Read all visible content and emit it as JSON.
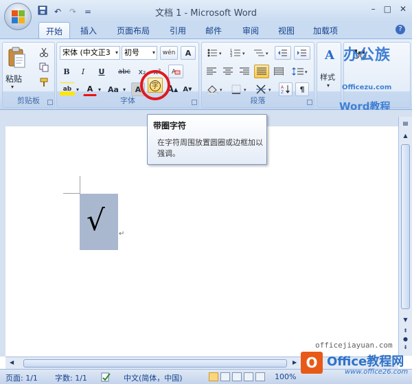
{
  "window": {
    "title": "文档 1 - Microsoft Word",
    "minimize_glyph": "–",
    "maximize_glyph": "□",
    "close_glyph": "✕"
  },
  "qat": {
    "save_icon": "save-icon",
    "undo_glyph": "↶",
    "redo_glyph": "↷",
    "customize_glyph": "="
  },
  "tabs": [
    "开始",
    "插入",
    "页面布局",
    "引用",
    "邮件",
    "审阅",
    "视图",
    "加载项"
  ],
  "help_glyph": "?",
  "ribbon": {
    "clipboard": {
      "label": "剪贴板",
      "paste_label": "粘贴"
    },
    "font": {
      "label": "字体",
      "font_name": "宋体 (中文正3",
      "font_size": "初号",
      "bold": "B",
      "italic": "I",
      "underline": "U",
      "strikethrough": "abc",
      "subscript": "x₂",
      "superscript": "x²",
      "highlight": "ab",
      "font_color": "A",
      "change_case": "Aa",
      "char_shading": "A",
      "enclose_char": "字",
      "grow_font": "A",
      "shrink_font": "A",
      "pinyin": "wén",
      "char_border": "A"
    },
    "paragraph": {
      "label": "段落"
    },
    "styles": {
      "label": "样式"
    }
  },
  "brand": {
    "line1": "办公族",
    "line2": "Officezu.com",
    "line3": "Word教程"
  },
  "tooltip": {
    "title": "带圈字符",
    "description": "在字符周围放置圆圈或边框加以强调。"
  },
  "document": {
    "content": "√",
    "para_mark": "↵"
  },
  "website": "officejiayuan.com",
  "status": {
    "page": "页面: 1/1",
    "words": "字数: 1/1",
    "language": "中文(简体，中国)",
    "zoom": "100%"
  },
  "logo2": {
    "mark": "O",
    "text": "Office教程网",
    "sub": "www.office26.com"
  }
}
